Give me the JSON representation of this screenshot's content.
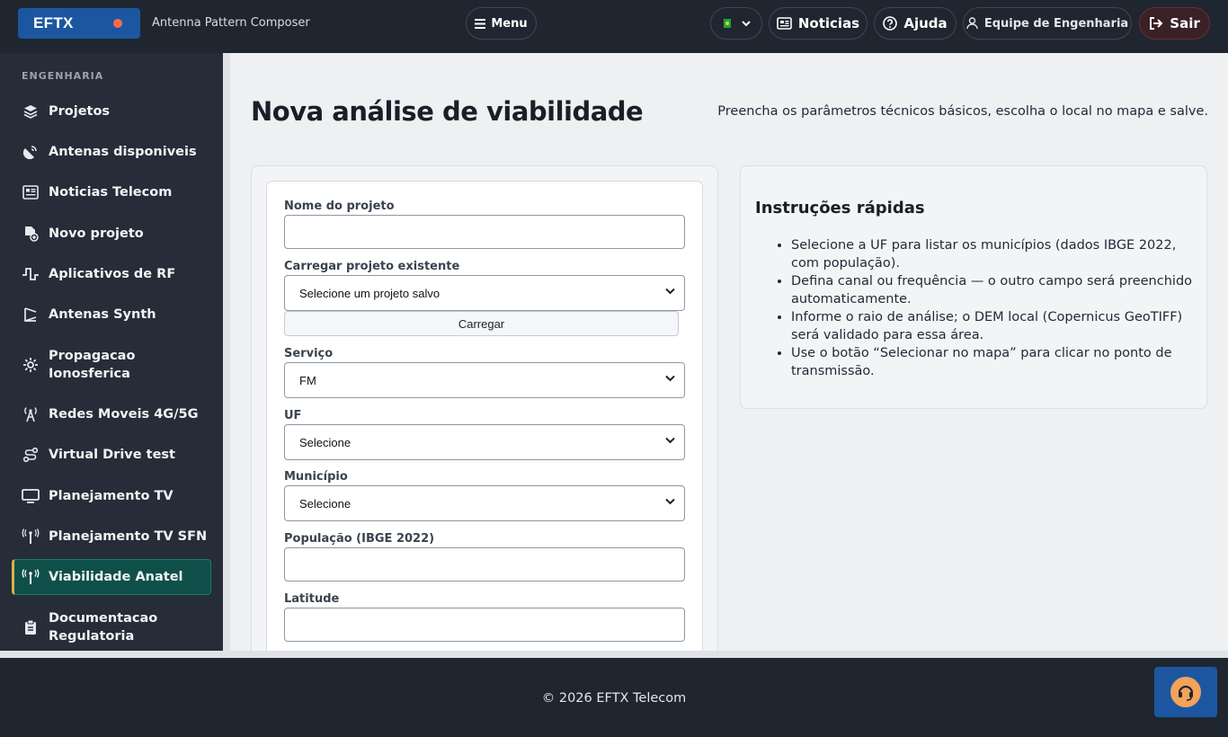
{
  "header": {
    "brand": "EFTX",
    "subtitle": "Antenna Pattern Composer",
    "menu_label": "Menu",
    "news_label": "Noticias",
    "help_label": "Ajuda",
    "user_label": "Equipe de Engenharia",
    "exit_label": "Sair"
  },
  "sidebar": {
    "section": "ENGENHARIA",
    "items": [
      {
        "label": "Projetos",
        "icon": "layers-icon"
      },
      {
        "label": "Antenas disponiveis",
        "icon": "satellite-dish-icon"
      },
      {
        "label": "Noticias Telecom",
        "icon": "newspaper-icon"
      },
      {
        "label": "Novo projeto",
        "icon": "new-file-icon"
      },
      {
        "label": "Aplicativos de RF",
        "icon": "waveform-icon"
      },
      {
        "label": "Antenas Synth",
        "icon": "antenna-synth-icon"
      },
      {
        "label": "Propagacao Ionosferica",
        "icon": "gear-icon"
      },
      {
        "label": "Redes Moveis 4G/5G",
        "icon": "cell-tower-icon"
      },
      {
        "label": "Virtual Drive test",
        "icon": "route-icon"
      },
      {
        "label": "Planejamento TV",
        "icon": "monitor-icon"
      },
      {
        "label": "Planejamento TV SFN",
        "icon": "broadcast-icon"
      },
      {
        "label": "Viabilidade Anatel",
        "icon": "broadcast-icon",
        "active": true
      },
      {
        "label": "Documentacao Regulatoria",
        "icon": "clipboard-icon"
      }
    ]
  },
  "main": {
    "title": "Nova análise de viabilidade",
    "description": "Preencha os parâmetros técnicos básicos, escolha o local no mapa e salve.",
    "form": {
      "project_name_label": "Nome do projeto",
      "project_name_value": "",
      "load_label": "Carregar projeto existente",
      "load_select": "Selecione um projeto salvo",
      "load_button": "Carregar",
      "service_label": "Serviço",
      "service_value": "FM",
      "uf_label": "UF",
      "uf_value": "Selecione",
      "municipio_label": "Município",
      "municipio_value": "Selecione",
      "population_label": "População (IBGE 2022)",
      "population_value": "",
      "latitude_label": "Latitude",
      "latitude_value": ""
    },
    "instructions": {
      "title": "Instruções rápidas",
      "items": [
        "Selecione a UF para listar os municípios (dados IBGE 2022, com população).",
        "Defina canal ou frequência — o outro campo será preenchido automaticamente.",
        "Informe o raio de análise; o DEM local (Copernicus GeoTIFF) será validado para essa área.",
        "Use o botão “Selecionar no mapa” para clicar no ponto de transmissão."
      ]
    }
  },
  "footer": {
    "copyright": "© 2026 EFTX Telecom"
  },
  "colors": {
    "topbar": "#1f2630",
    "sidebar": "#262d38",
    "brand": "#1d56a0",
    "active_item": "#0f4f4a",
    "active_accent": "#d6b24a",
    "support": "#f5a25a"
  }
}
